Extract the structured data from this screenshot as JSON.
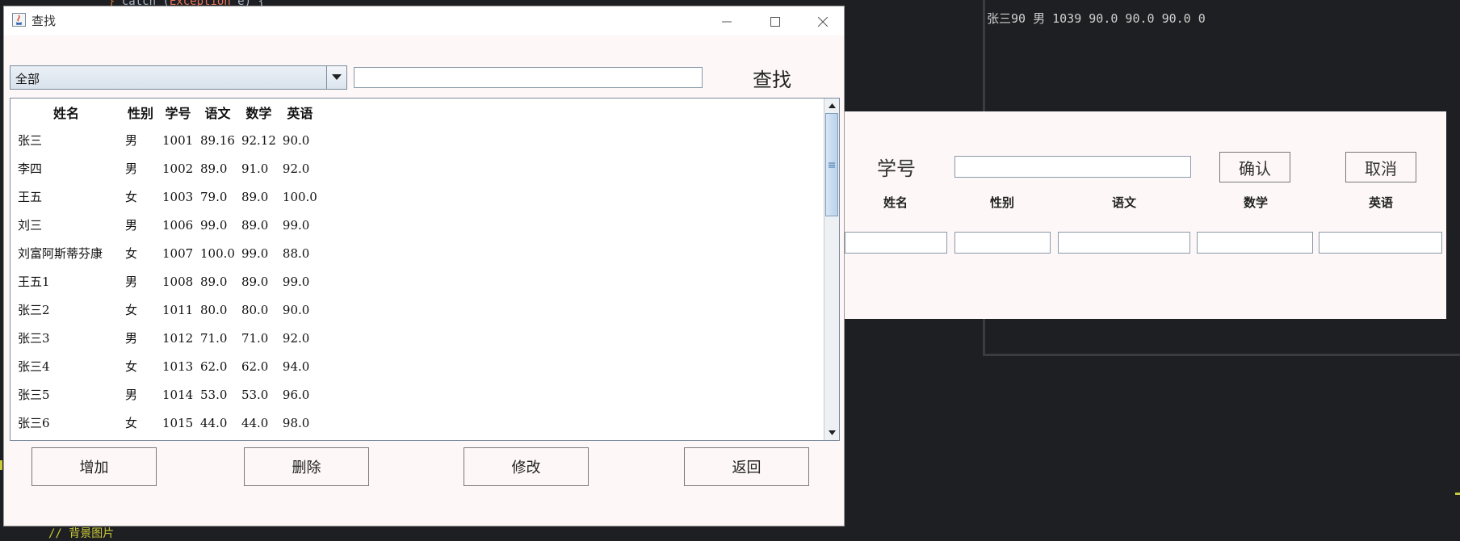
{
  "background": {
    "code_line": "} catch (Exception e) {",
    "comment_line": "// 背景图片"
  },
  "console": {
    "output": "张三90 男 1039 90.0 90.0 90.0 0"
  },
  "search_window": {
    "title": "查找",
    "filter": {
      "selected": "全部"
    },
    "search": {
      "value": "",
      "label": "查找"
    },
    "table": {
      "headers": [
        "姓名",
        "性别",
        "学号",
        "语文",
        "数学",
        "英语"
      ],
      "rows": [
        [
          "张三",
          "男",
          "1001",
          "89.16",
          "92.12",
          "90.0"
        ],
        [
          "李四",
          "男",
          "1002",
          "89.0",
          "91.0",
          "92.0"
        ],
        [
          "王五",
          "女",
          "1003",
          "79.0",
          "89.0",
          "100.0"
        ],
        [
          "刘三",
          "男",
          "1006",
          "99.0",
          "89.0",
          "99.0"
        ],
        [
          "刘富阿斯蒂芬康",
          "女",
          "1007",
          "100.0",
          "99.0",
          "88.0"
        ],
        [
          "王五1",
          "男",
          "1008",
          "89.0",
          "89.0",
          "99.0"
        ],
        [
          "张三2",
          "女",
          "1011",
          "80.0",
          "80.0",
          "90.0"
        ],
        [
          "张三3",
          "男",
          "1012",
          "71.0",
          "71.0",
          "92.0"
        ],
        [
          "张三4",
          "女",
          "1013",
          "62.0",
          "62.0",
          "94.0"
        ],
        [
          "张三5",
          "男",
          "1014",
          "53.0",
          "53.0",
          "96.0"
        ],
        [
          "张三6",
          "女",
          "1015",
          "44.0",
          "44.0",
          "98.0"
        ]
      ]
    },
    "buttons": {
      "add": "增加",
      "delete": "删除",
      "modify": "修改",
      "back": "返回"
    }
  },
  "edit_window": {
    "id_label": "学号",
    "id_value": "",
    "confirm": "确认",
    "cancel": "取消",
    "columns": [
      "姓名",
      "性别",
      "语文",
      "数学",
      "英语"
    ]
  }
}
